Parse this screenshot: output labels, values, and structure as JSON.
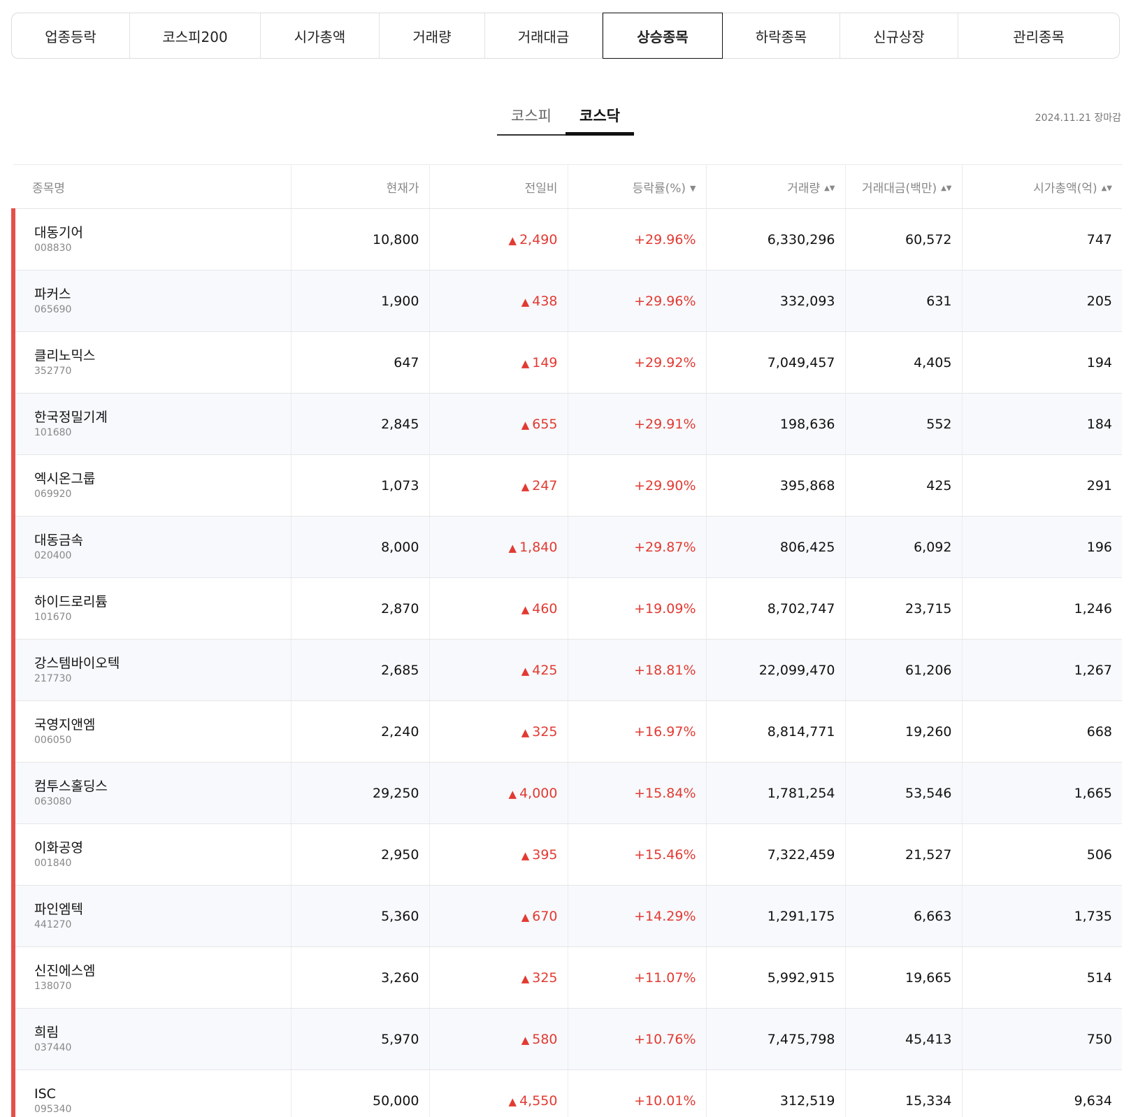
{
  "top_tabs": [
    {
      "label": "업종등락",
      "active": false
    },
    {
      "label": "코스피200",
      "active": false
    },
    {
      "label": "시가총액",
      "active": false
    },
    {
      "label": "거래량",
      "active": false
    },
    {
      "label": "거래대금",
      "active": false
    },
    {
      "label": "상승종목",
      "active": true
    },
    {
      "label": "하락종목",
      "active": false
    },
    {
      "label": "신규상장",
      "active": false
    },
    {
      "label": "관리종목",
      "active": false
    }
  ],
  "market_tabs": [
    {
      "label": "코스피",
      "active": false
    },
    {
      "label": "코스닥",
      "active": true
    }
  ],
  "updated_text": "2024.11.21 장마감",
  "columns": {
    "name": "종목명",
    "price": "현재가",
    "change": "전일비",
    "rate": "등락률(%)",
    "volume": "거래량",
    "amount": "거래대금(백만)",
    "mcap": "시가총액(억)"
  },
  "icons": {
    "sort_desc": "▼",
    "sort_both": "▲▼",
    "up_arrow": "▲"
  },
  "colors": {
    "up": "#e23a32",
    "row_marker": "#e5504a"
  },
  "rows": [
    {
      "name": "대동기어",
      "code": "008830",
      "price": "10,800",
      "change": "2,490",
      "rate": "+29.96%",
      "volume": "6,330,296",
      "amount": "60,572",
      "mcap": "747"
    },
    {
      "name": "파커스",
      "code": "065690",
      "price": "1,900",
      "change": "438",
      "rate": "+29.96%",
      "volume": "332,093",
      "amount": "631",
      "mcap": "205"
    },
    {
      "name": "클리노믹스",
      "code": "352770",
      "price": "647",
      "change": "149",
      "rate": "+29.92%",
      "volume": "7,049,457",
      "amount": "4,405",
      "mcap": "194"
    },
    {
      "name": "한국정밀기계",
      "code": "101680",
      "price": "2,845",
      "change": "655",
      "rate": "+29.91%",
      "volume": "198,636",
      "amount": "552",
      "mcap": "184"
    },
    {
      "name": "엑시온그룹",
      "code": "069920",
      "price": "1,073",
      "change": "247",
      "rate": "+29.90%",
      "volume": "395,868",
      "amount": "425",
      "mcap": "291"
    },
    {
      "name": "대동금속",
      "code": "020400",
      "price": "8,000",
      "change": "1,840",
      "rate": "+29.87%",
      "volume": "806,425",
      "amount": "6,092",
      "mcap": "196"
    },
    {
      "name": "하이드로리튬",
      "code": "101670",
      "price": "2,870",
      "change": "460",
      "rate": "+19.09%",
      "volume": "8,702,747",
      "amount": "23,715",
      "mcap": "1,246"
    },
    {
      "name": "강스템바이오텍",
      "code": "217730",
      "price": "2,685",
      "change": "425",
      "rate": "+18.81%",
      "volume": "22,099,470",
      "amount": "61,206",
      "mcap": "1,267"
    },
    {
      "name": "국영지앤엠",
      "code": "006050",
      "price": "2,240",
      "change": "325",
      "rate": "+16.97%",
      "volume": "8,814,771",
      "amount": "19,260",
      "mcap": "668"
    },
    {
      "name": "컴투스홀딩스",
      "code": "063080",
      "price": "29,250",
      "change": "4,000",
      "rate": "+15.84%",
      "volume": "1,781,254",
      "amount": "53,546",
      "mcap": "1,665"
    },
    {
      "name": "이화공영",
      "code": "001840",
      "price": "2,950",
      "change": "395",
      "rate": "+15.46%",
      "volume": "7,322,459",
      "amount": "21,527",
      "mcap": "506"
    },
    {
      "name": "파인엠텍",
      "code": "441270",
      "price": "5,360",
      "change": "670",
      "rate": "+14.29%",
      "volume": "1,291,175",
      "amount": "6,663",
      "mcap": "1,735"
    },
    {
      "name": "신진에스엠",
      "code": "138070",
      "price": "3,260",
      "change": "325",
      "rate": "+11.07%",
      "volume": "5,992,915",
      "amount": "19,665",
      "mcap": "514"
    },
    {
      "name": "희림",
      "code": "037440",
      "price": "5,970",
      "change": "580",
      "rate": "+10.76%",
      "volume": "7,475,798",
      "amount": "45,413",
      "mcap": "750"
    },
    {
      "name": "ISC",
      "code": "095340",
      "price": "50,000",
      "change": "4,550",
      "rate": "+10.01%",
      "volume": "312,519",
      "amount": "15,334",
      "mcap": "9,634"
    }
  ]
}
